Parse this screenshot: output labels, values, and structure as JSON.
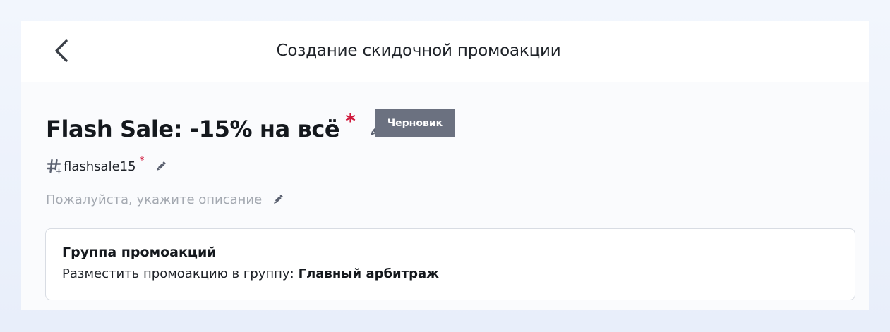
{
  "header": {
    "title": "Создание скидочной промоакции",
    "back_icon": "chevron-left-icon"
  },
  "promo": {
    "name": "Flash Sale: -15% на всё",
    "required_mark": "*",
    "status": "Черновик",
    "code": "flashsale15",
    "code_required_mark": "*",
    "description_placeholder": "Пожалуйста, укажите описание"
  },
  "group": {
    "title": "Группа промоакций",
    "label": "Разместить промоакцию в группу:",
    "value": "Главный арбитраж"
  },
  "colors": {
    "required": "#d0183b",
    "badge_bg": "#6b7180",
    "placeholder": "#a4a9b1"
  }
}
